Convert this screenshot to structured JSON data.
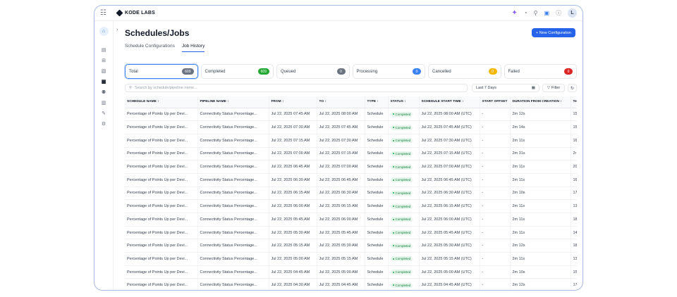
{
  "topbar": {
    "brand": "KODE LABS",
    "avatar": "L"
  },
  "header": {
    "title": "Schedules/Jobs",
    "new_button": "+ New Configuration"
  },
  "tabs": [
    {
      "label": "Schedule Configurations"
    },
    {
      "label": "Job History"
    }
  ],
  "status_cards": [
    {
      "label": "Total",
      "count": "609",
      "color": "#6b7280"
    },
    {
      "label": "Completed",
      "count": "609",
      "color": "#22a833"
    },
    {
      "label": "Queued",
      "count": "0",
      "color": "#6b7280"
    },
    {
      "label": "Processing",
      "count": "0",
      "color": "#3b82f6"
    },
    {
      "label": "Cancelled",
      "count": "0",
      "color": "#f5b800"
    },
    {
      "label": "Failed",
      "count": "0",
      "color": "#dc2626"
    }
  ],
  "search": {
    "placeholder": "Search by schedule/pipeline name..."
  },
  "date_range": "Last 7 Days",
  "filter_label": "Filter",
  "columns": [
    "SCHEDULE NAME ↕",
    "PIPELINE NAME ↕",
    "FROM ↕",
    "TO ↕",
    "TYPE ↕",
    "STATUS ↕",
    "SCHEDULE START TIME ↕",
    "START OFFSET",
    "DURATION FROM CREATION ↕",
    "Te"
  ],
  "rows": [
    [
      "Percentage of Points Up per Devi...",
      "Connectivity Status Percentage...",
      "Jul 22, 2025 07:45 AM",
      "Jul 22, 2025 08:00 AM",
      "Schedule",
      "Completed",
      "Jul 22, 2025 08:00 AM (UTC)",
      "-",
      "2m 12s",
      "15"
    ],
    [
      "Percentage of Points Up per Devi...",
      "Connectivity Status Percentage...",
      "Jul 22, 2025 07:30 AM",
      "Jul 22, 2025 07:45 AM",
      "Schedule",
      "Completed",
      "Jul 22, 2025 07:45 AM (UTC)",
      "-",
      "2m 14s",
      "15"
    ],
    [
      "Percentage of Points Up per Devi...",
      "Connectivity Status Percentage...",
      "Jul 22, 2025 07:15 AM",
      "Jul 22, 2025 07:30 AM",
      "Schedule",
      "Completed",
      "Jul 22, 2025 07:30 AM (UTC)",
      "-",
      "2m 11s",
      "16"
    ],
    [
      "Percentage of Points Up per Devi...",
      "Connectivity Status Percentage...",
      "Jul 22, 2025 07:00 AM",
      "Jul 22, 2025 07:15 AM",
      "Schedule",
      "Completed",
      "Jul 22, 2025 07:15 AM (UTC)",
      "-",
      "2m 31s",
      "2r"
    ],
    [
      "Percentage of Points Up per Devi...",
      "Connectivity Status Percentage...",
      "Jul 22, 2025 06:45 AM",
      "Jul 22, 2025 07:00 AM",
      "Schedule",
      "Completed",
      "Jul 22, 2025 07:00 AM (UTC)",
      "-",
      "2m 11s",
      "20"
    ],
    [
      "Percentage of Points Up per Devi...",
      "Connectivity Status Percentage...",
      "Jul 22, 2025 06:30 AM",
      "Jul 22, 2025 06:45 AM",
      "Schedule",
      "Completed",
      "Jul 22, 2025 06:45 AM (UTC)",
      "-",
      "2m 11s",
      "16"
    ],
    [
      "Percentage of Points Up per Devi...",
      "Connectivity Status Percentage...",
      "Jul 22, 2025 06:15 AM",
      "Jul 22, 2025 06:30 AM",
      "Schedule",
      "Completed",
      "Jul 22, 2025 06:30 AM (UTC)",
      "-",
      "2m 10s",
      "17"
    ],
    [
      "Percentage of Points Up per Devi...",
      "Connectivity Status Percentage...",
      "Jul 22, 2025 06:00 AM",
      "Jul 22, 2025 06:15 AM",
      "Schedule",
      "Completed",
      "Jul 22, 2025 06:15 AM (UTC)",
      "-",
      "2m 11s",
      "13"
    ],
    [
      "Percentage of Points Up per Devi...",
      "Connectivity Status Percentage...",
      "Jul 22, 2025 05:45 AM",
      "Jul 22, 2025 06:00 AM",
      "Schedule",
      "Completed",
      "Jul 22, 2025 06:00 AM (UTC)",
      "-",
      "2m 11s",
      "18"
    ],
    [
      "Percentage of Points Up per Devi...",
      "Connectivity Status Percentage...",
      "Jul 22, 2025 05:30 AM",
      "Jul 22, 2025 05:45 AM",
      "Schedule",
      "Completed",
      "Jul 22, 2025 05:45 AM (UTC)",
      "-",
      "2m 11s",
      "14"
    ],
    [
      "Percentage of Points Up per Devi...",
      "Connectivity Status Percentage...",
      "Jul 22, 2025 05:15 AM",
      "Jul 22, 2025 05:30 AM",
      "Schedule",
      "Completed",
      "Jul 22, 2025 05:30 AM (UTC)",
      "-",
      "2m 12s",
      "18"
    ],
    [
      "Percentage of Points Up per Devi...",
      "Connectivity Status Percentage...",
      "Jul 22, 2025 05:00 AM",
      "Jul 22, 2025 05:15 AM",
      "Schedule",
      "Completed",
      "Jul 22, 2025 05:15 AM (UTC)",
      "-",
      "2m 11s",
      "13"
    ],
    [
      "Percentage of Points Up per Devi...",
      "Connectivity Status Percentage...",
      "Jul 22, 2025 04:45 AM",
      "Jul 22, 2025 05:00 AM",
      "Schedule",
      "Completed",
      "Jul 22, 2025 05:00 AM (UTC)",
      "-",
      "2m 10s",
      "15"
    ],
    [
      "Percentage of Points Up per Devi...",
      "Connectivity Status Percentage...",
      "Jul 22, 2025 04:30 AM",
      "Jul 22, 2025 04:45 AM",
      "Schedule",
      "Completed",
      "Jul 22, 2025 04:45 AM (UTC)",
      "-",
      "2m 12s",
      "17"
    ]
  ]
}
